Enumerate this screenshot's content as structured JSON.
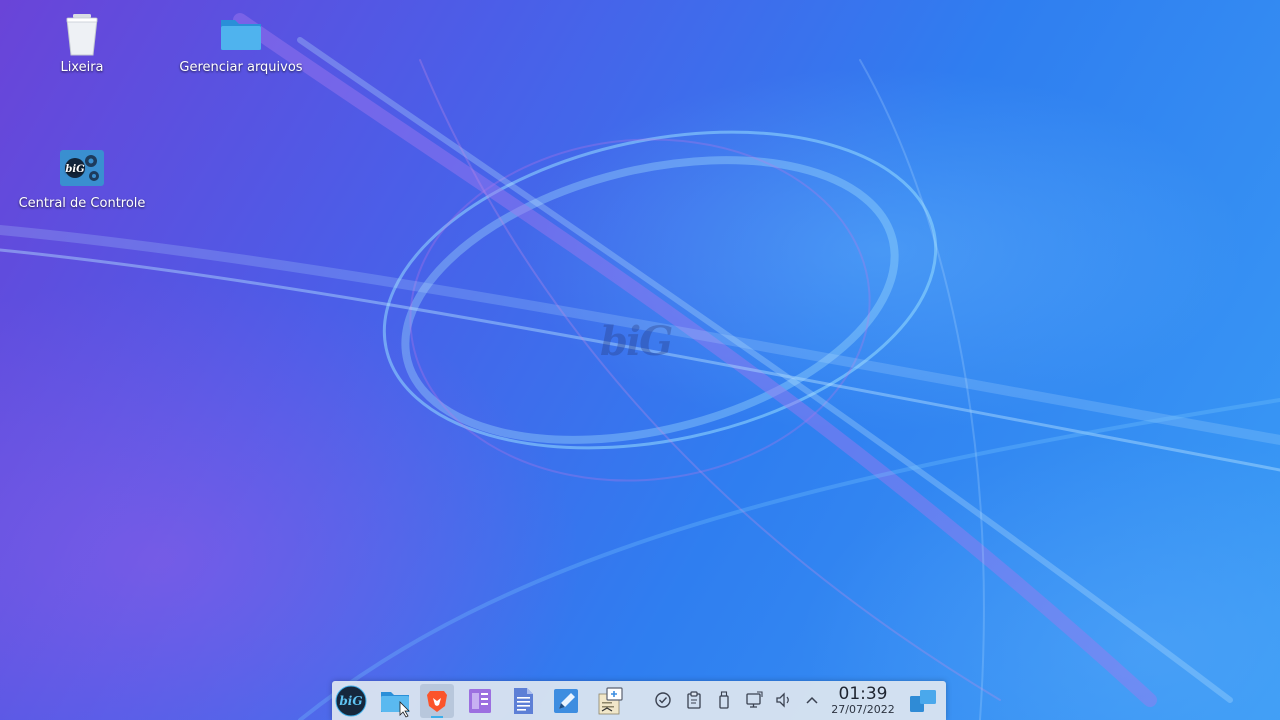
{
  "desktop": {
    "watermark": "biG",
    "icons": [
      {
        "label": "Lixeira",
        "icon": "trash-icon"
      },
      {
        "label": "Gerenciar arquivos",
        "icon": "folder-icon"
      },
      {
        "label": "Central de Controle",
        "icon": "control-center-icon"
      }
    ]
  },
  "taskbar": {
    "launchers": [
      {
        "name": "app-menu-button",
        "icon": "biglinux-logo-icon"
      },
      {
        "name": "file-manager-button",
        "icon": "folder-icon"
      },
      {
        "name": "brave-browser-button",
        "icon": "brave-lion-icon",
        "active": true
      },
      {
        "name": "document-viewer-button",
        "icon": "document-viewer-icon"
      },
      {
        "name": "text-document-button",
        "icon": "text-document-icon"
      },
      {
        "name": "text-editor-button",
        "icon": "pencil-edit-icon"
      },
      {
        "name": "screenshot-tool-button",
        "icon": "screenshot-icon"
      }
    ],
    "tray": [
      {
        "name": "updates-status",
        "icon": "check-circle-icon"
      },
      {
        "name": "clipboard",
        "icon": "clipboard-icon"
      },
      {
        "name": "removable-devices",
        "icon": "usb-drive-icon"
      },
      {
        "name": "network",
        "icon": "network-monitor-icon"
      },
      {
        "name": "volume",
        "icon": "speaker-icon"
      },
      {
        "name": "show-hidden-icons",
        "icon": "chevron-up-icon"
      }
    ],
    "clock": {
      "time": "01:39",
      "date": "27/07/2022"
    },
    "show_desktop_icon": "show-desktop-icon"
  },
  "colors": {
    "wallpaper_blue": "#2f7ef0",
    "wallpaper_purple": "#6a44d8",
    "taskbar_bg": "#dee6f0",
    "accent": "#3daee9"
  }
}
